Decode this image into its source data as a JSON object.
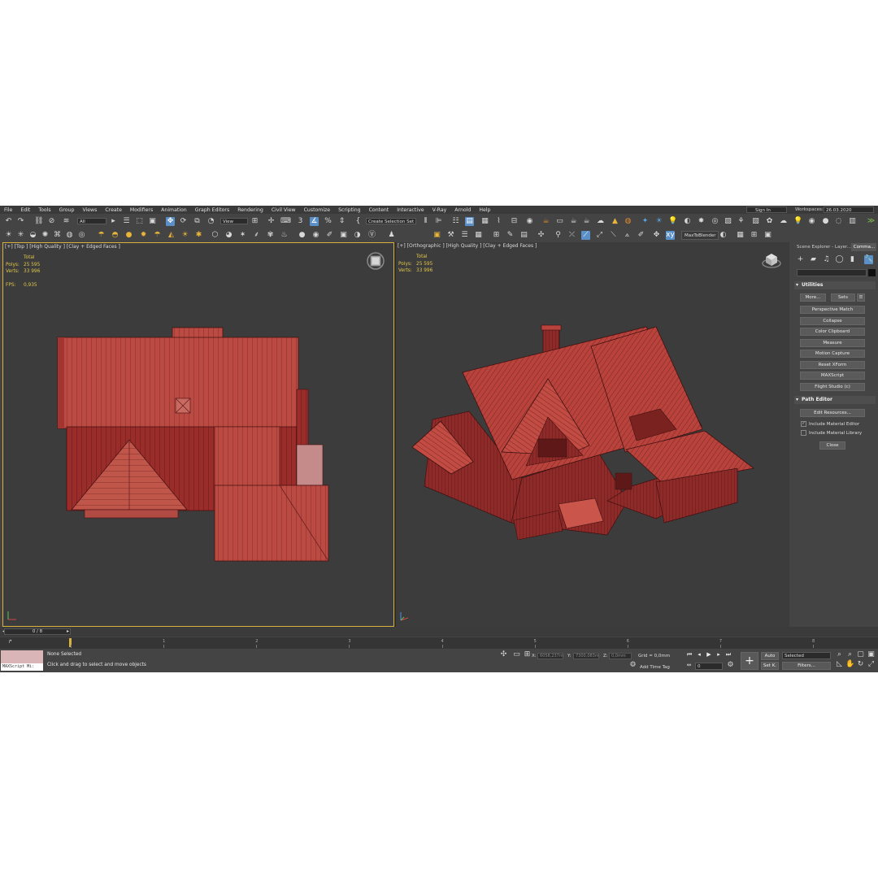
{
  "menu": [
    "File",
    "Edit",
    "Tools",
    "Group",
    "Views",
    "Create",
    "Modifiers",
    "Animation",
    "Graph Editors",
    "Rendering",
    "Civil View",
    "Customize",
    "Scripting",
    "Content",
    "Interactive",
    "V-Ray",
    "Arnold",
    "Help"
  ],
  "account": {
    "signin": "Sign In",
    "workspaces_label": "Workspaces:",
    "workspace_value": "26.03.2020"
  },
  "toolbar": {
    "filter": "All",
    "ref_coord": "View",
    "selection_set": "Create Selection Set",
    "plugin_button": "MaxToBlender"
  },
  "viewports": {
    "left": {
      "label": "[+] [Top ] [High Quality ] [Clay + Edged Faces ]",
      "stats_header": "Total",
      "polys_label": "Polys:",
      "polys": "25 595",
      "verts_label": "Verts:",
      "verts": "33 996",
      "fps_label": "FPS:",
      "fps": "0,935"
    },
    "right": {
      "label": "[+] [Orthographic ] [High Quality ] [Clay + Edged Faces ]",
      "stats_header": "Total",
      "polys_label": "Polys:",
      "polys": "25 595",
      "verts_label": "Verts:",
      "verts": "33 996"
    }
  },
  "command_panel": {
    "tabs": [
      "Scene Explorer - Layer...",
      "Comma..."
    ],
    "utilities": {
      "title": "Utilities",
      "more": "More...",
      "sets": "Sets",
      "buttons": [
        "Perspective Match",
        "Collapse",
        "Color Clipboard",
        "Measure",
        "Motion Capture",
        "Reset XForm",
        "MAXScript",
        "Flight Studio (c)"
      ]
    },
    "path_editor": {
      "title": "Path Editor",
      "edit_resources": "Edit Resources...",
      "include_material_editor": "Include Material Editor",
      "include_material_library": "Include Material Library",
      "close": "Close"
    }
  },
  "timeline": {
    "slider": "0 / 8",
    "ticks": [
      "0",
      "1",
      "2",
      "3",
      "4",
      "5",
      "6",
      "7",
      "8"
    ]
  },
  "status": {
    "maxscript_listener": "MAXScript Mi:",
    "selection": "None Selected",
    "prompt": "Click and drag to select and move objects",
    "x_label": "X:",
    "x": "6058,237m",
    "y_label": "Y:",
    "y": "7300,083m",
    "z_label": "Z:",
    "z": "0,0mm",
    "grid": "Grid = 0,0mm",
    "add_time_tag": "Add Time Tag",
    "auto": "Auto",
    "set_key": "Set K.",
    "selected": "Selected",
    "filters": "Filters...",
    "frame": "0"
  },
  "colors": {
    "roof": "#b9433c",
    "wall": "#8e2424",
    "viewport_bg": "#3c3c3c",
    "active_border": "#d9b23c"
  }
}
